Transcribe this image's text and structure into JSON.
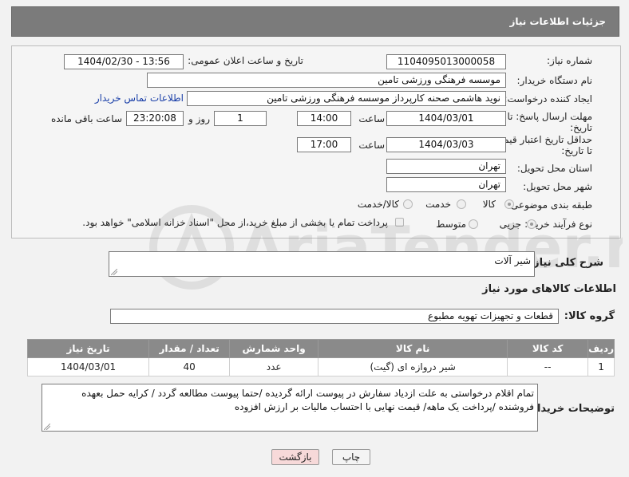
{
  "header": {
    "title": "جزئیات اطلاعات نیاز"
  },
  "form": {
    "need_number_label": "شماره نیاز:",
    "need_number": "1104095013000058",
    "announce_label": "تاریخ و ساعت اعلان عمومی:",
    "announce_value": "1404/02/30 - 13:56",
    "buyer_org_label": "نام دستگاه خریدار:",
    "buyer_org": "موسسه فرهنگی ورزشی تامین",
    "creator_label": "ایجاد کننده درخواست:",
    "creator": "نوید هاشمی صحنه کارپرداز موسسه فرهنگی ورزشی تامین",
    "buyer_contact_link": "اطلاعات تماس خریدار",
    "deadline_label_1": "مهلت ارسال پاسخ: تا",
    "deadline_label_2": "تاریخ:",
    "deadline_date": "1404/03/01",
    "time_label": "ساعت",
    "deadline_time": "14:00",
    "days_value": "1",
    "days_label": "روز و",
    "remaining_time": "23:20:08",
    "remaining_label": "ساعت باقی مانده",
    "validity_label_1": "حداقل تاریخ اعتبار قیمت:",
    "validity_label_2": "تا تاریخ:",
    "validity_date": "1404/03/03",
    "validity_time": "17:00",
    "province_label": "استان محل تحویل:",
    "province": "تهران",
    "city_label": "شهر محل تحویل:",
    "city": "تهران",
    "category_label": "طبقه بندی موضوعی:",
    "category_options": [
      "کالا",
      "خدمت",
      "کالا/خدمت"
    ],
    "category_selected": "کالا",
    "process_label": "نوع فرآیند خرید :",
    "process_options": [
      "جزیی",
      "متوسط"
    ],
    "process_selected": "جزیی",
    "payment_note": "پرداخت تمام یا بخشی از مبلغ خرید،از محل \"اسناد خزانه اسلامی\" خواهد بود."
  },
  "description": {
    "label": "شرح کلی نیاز:",
    "value": "شیر آلات"
  },
  "goods": {
    "section_title": "اطلاعات کالاهای مورد نیاز",
    "group_label": "گروه کالا:",
    "group_value": "قطعات و تجهیزات تهویه مطبوع",
    "columns": [
      "ردیف",
      "کد کالا",
      "نام کالا",
      "واحد شمارش",
      "تعداد / مقدار",
      "تاریخ نیاز"
    ],
    "rows": [
      {
        "row": "1",
        "code": "--",
        "name": "شیر دروازه ای (گیت)",
        "unit": "عدد",
        "qty": "40",
        "date": "1404/03/01"
      }
    ]
  },
  "buyer_notes": {
    "label": "توضیحات خریدار:",
    "value": "تمام اقلام درخواستی به علت ازدیاد سفارش در پیوست ارائه گردیده /حتما پیوست مطالعه گردد / کرایه حمل بعهده فروشنده /پرداخت یک ماهه/ قیمت نهایی با احتساب مالیات بر ارزش افزوده"
  },
  "buttons": {
    "print": "چاپ",
    "back": "بازگشت"
  },
  "watermark": {
    "text": "AriaTender.net"
  },
  "colors": {
    "header_bg": "#7b7b7b",
    "table_header_bg": "#8a8a8a",
    "back_button_bg": "#f7d9d9",
    "link": "#1a3fa8"
  }
}
